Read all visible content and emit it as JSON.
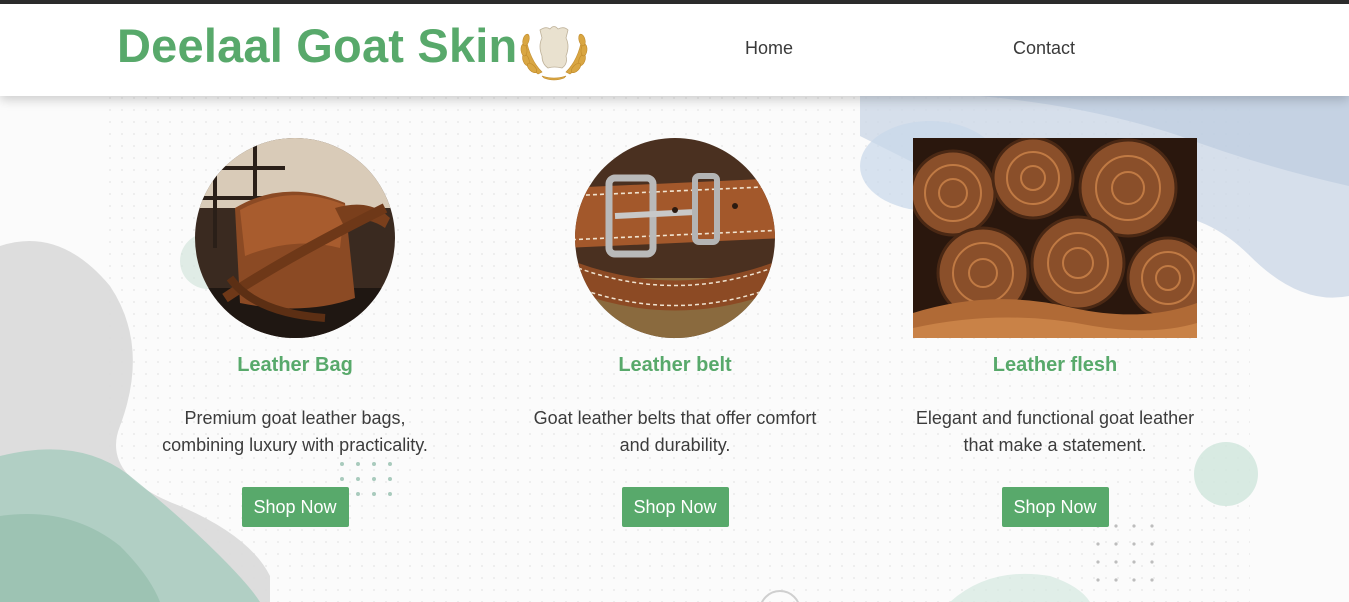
{
  "brand": {
    "title": "Deelaal Goat Skin",
    "accent_color": "#58a96b"
  },
  "nav": {
    "items": [
      {
        "label": "Home"
      },
      {
        "label": "Contact"
      }
    ]
  },
  "products": [
    {
      "title": "Leather Bag",
      "description": "Premium goat leather bags, combining luxury with practicality.",
      "button_label": "Shop Now",
      "image": "leather-bag-photo"
    },
    {
      "title": "Leather belt",
      "description": "Goat leather belts that offer comfort and durability.",
      "button_label": "Shop Now",
      "image": "leather-belt-photo"
    },
    {
      "title": "Leather flesh",
      "description": "Elegant and functional goat leather that make a statement.",
      "button_label": "Shop Now",
      "image": "leather-rolls-photo"
    }
  ],
  "colors": {
    "button_bg": "#58a96b",
    "title_green": "#58a96b",
    "top_border": "#2d2d2d"
  }
}
